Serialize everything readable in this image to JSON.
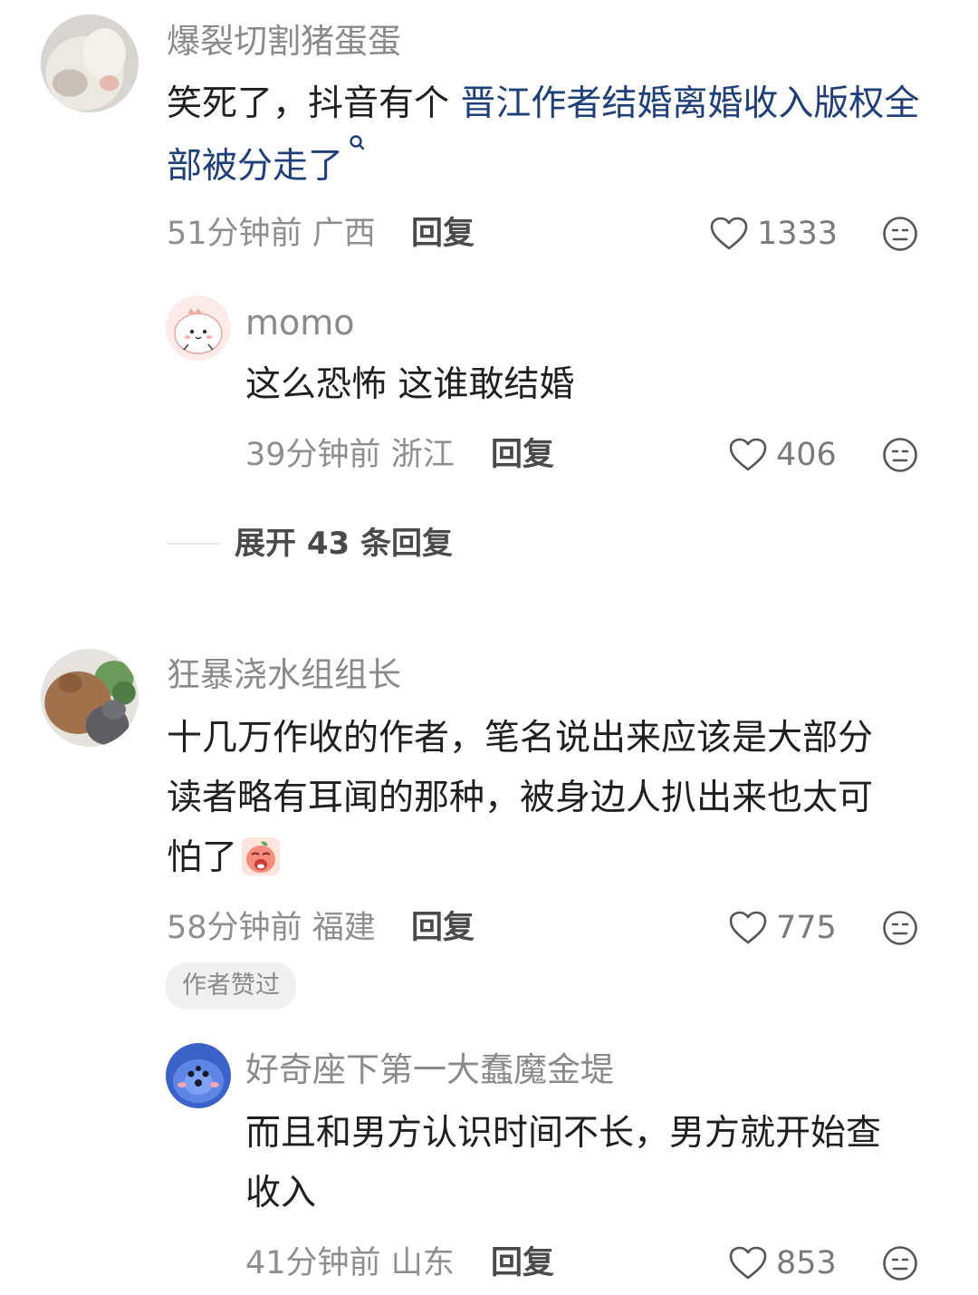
{
  "comments": [
    {
      "username": "爆裂切割猪蛋蛋",
      "text_before": "笑死了，抖音有个 ",
      "link_text": "晋江作者结婚离婚收入版权全部被分走了",
      "link_icon": "search-icon",
      "time": "51分钟前",
      "location": "广西",
      "reply_label": "回复",
      "likes": "1333",
      "reaction_icon": "neutral-face-icon",
      "replies": [
        {
          "username": "momo",
          "text": "这么恐怖 这谁敢结婚",
          "time": "39分钟前",
          "location": "浙江",
          "reply_label": "回复",
          "likes": "406"
        }
      ],
      "expand_label": "展开 43 条回复"
    },
    {
      "username": "狂暴浇水组组长",
      "text_line1": "十几万作收的作者，笔名说出来应该是大部分",
      "text_line2": "读者略有耳闻的那种，被身边人扒出来也太可",
      "text_line3": "怕了",
      "emoji": "crying-peach-emoji",
      "time": "58分钟前",
      "location": "福建",
      "reply_label": "回复",
      "likes": "775",
      "author_badge": "作者赞过",
      "replies": [
        {
          "username": "好奇座下第一大蠢魔金堤",
          "text_line1": "而且和男方认识时间不长，男方就开始查",
          "text_line2": "收入",
          "time": "41分钟前",
          "location": "山东",
          "reply_label": "回复",
          "likes": "853"
        }
      ]
    }
  ]
}
